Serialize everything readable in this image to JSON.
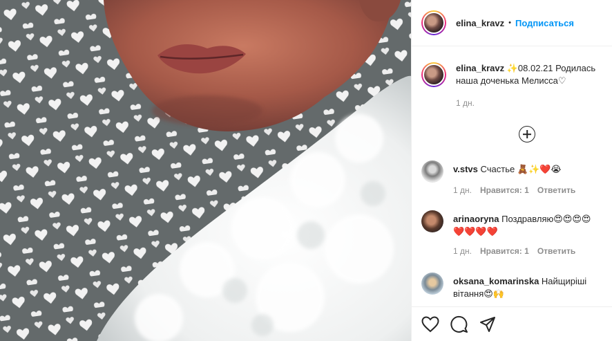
{
  "post": {
    "author": "elina_kravz",
    "follow_label": "Подписаться",
    "dot": "•",
    "caption": {
      "username": "elina_kravz",
      "text": "✨08.02.21 Родилась наша доченька Мелисса♡",
      "time": "1 дн."
    },
    "expand_icon": "plus-circle-icon",
    "comments": [
      {
        "username": "v.stvs",
        "text": "Счастье 🧸✨❤️😭",
        "time": "1 дн.",
        "likes": "Нравится: 1",
        "reply": "Ответить"
      },
      {
        "username": "arinaoryna",
        "text": "Поздравляю😍😍😍😍❤️❤️❤️❤️",
        "time": "1 дн.",
        "likes": "Нравится: 1",
        "reply": "Ответить"
      },
      {
        "username": "oksana_komarinska",
        "text": "Найщиріші вітання😍🙌"
      }
    ],
    "actions": [
      "heart-icon",
      "comment-icon",
      "share-icon"
    ]
  },
  "colors": {
    "accent": "#0095f6",
    "text": "#262626",
    "muted": "#8e8e8e",
    "border": "#efefef"
  }
}
